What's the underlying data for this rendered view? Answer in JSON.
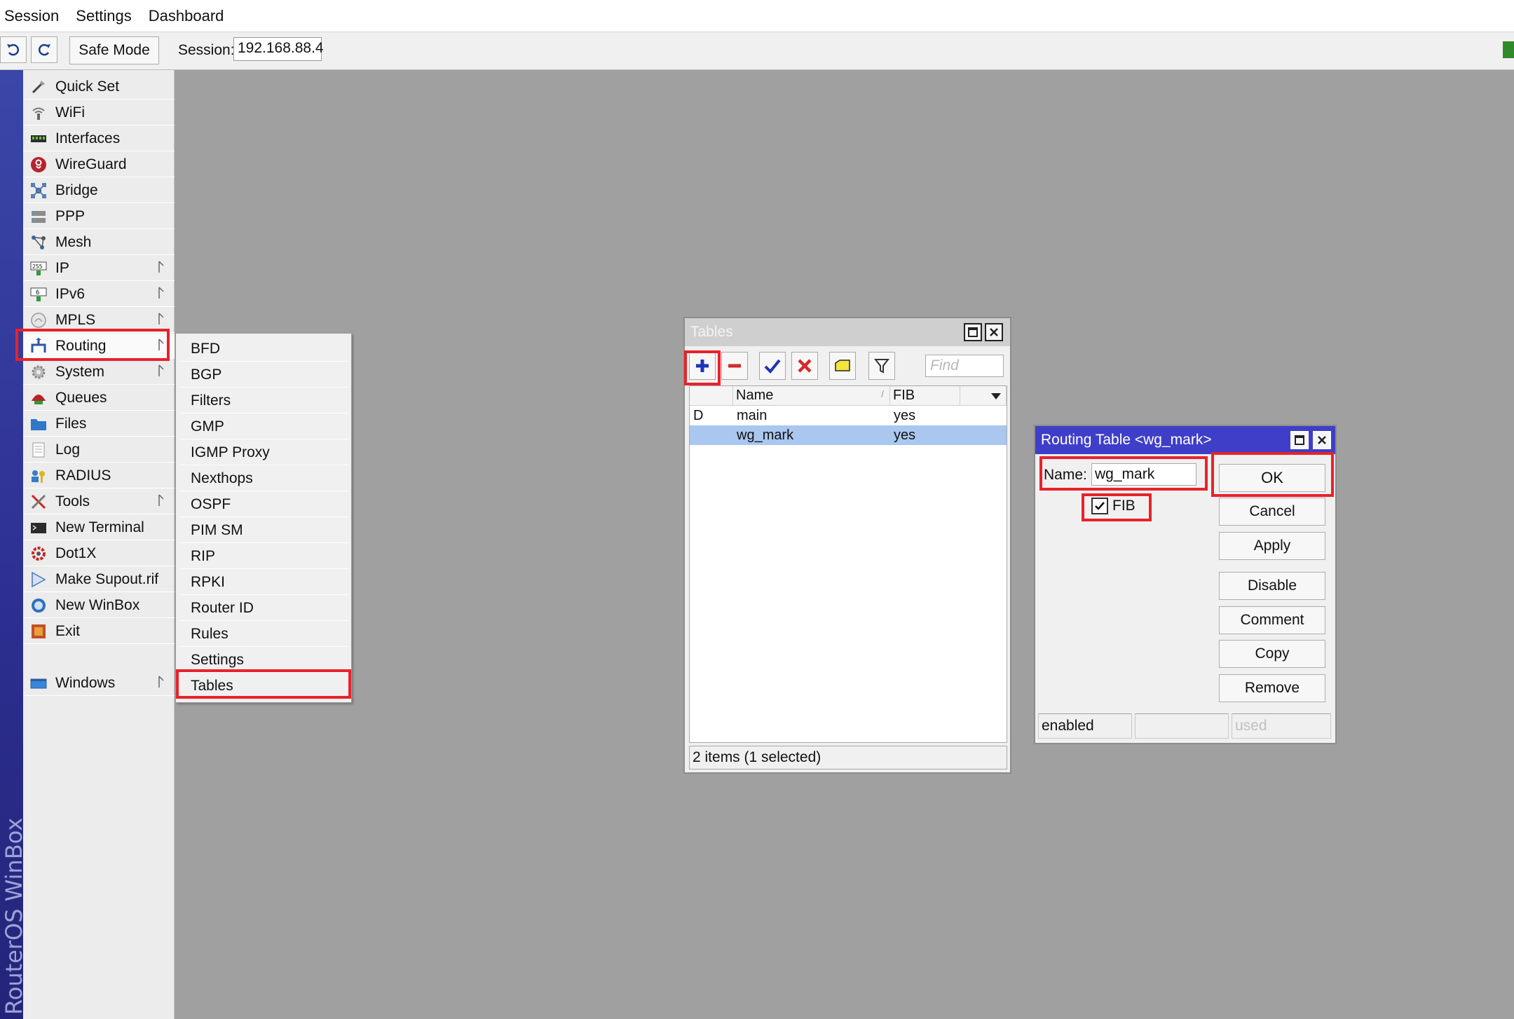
{
  "menubar": {
    "items": [
      "Session",
      "Settings",
      "Dashboard"
    ]
  },
  "toolbar": {
    "undo_icon": "undo-icon",
    "redo_icon": "redo-icon",
    "safe_mode_label": "Safe Mode",
    "session_label": "Session:",
    "session_value": "192.168.88.4"
  },
  "brand": {
    "vertical_label": "RouterOS WinBox"
  },
  "sidebar": {
    "items": [
      {
        "label": "Quick Set",
        "icon": "wand-icon",
        "has_submenu": false
      },
      {
        "label": "WiFi",
        "icon": "wifi-icon",
        "has_submenu": false
      },
      {
        "label": "Interfaces",
        "icon": "interfaces-icon",
        "has_submenu": false
      },
      {
        "label": "WireGuard",
        "icon": "wireguard-icon",
        "has_submenu": false
      },
      {
        "label": "Bridge",
        "icon": "bridge-icon",
        "has_submenu": false
      },
      {
        "label": "PPP",
        "icon": "ppp-icon",
        "has_submenu": false
      },
      {
        "label": "Mesh",
        "icon": "mesh-icon",
        "has_submenu": false
      },
      {
        "label": "IP",
        "icon": "ip-icon",
        "has_submenu": true
      },
      {
        "label": "IPv6",
        "icon": "ipv6-icon",
        "has_submenu": true
      },
      {
        "label": "MPLS",
        "icon": "mpls-icon",
        "has_submenu": true
      },
      {
        "label": "Routing",
        "icon": "routing-icon",
        "has_submenu": true
      },
      {
        "label": "System",
        "icon": "gear-icon",
        "has_submenu": true
      },
      {
        "label": "Queues",
        "icon": "queues-icon",
        "has_submenu": false
      },
      {
        "label": "Files",
        "icon": "folder-icon",
        "has_submenu": false
      },
      {
        "label": "Log",
        "icon": "log-icon",
        "has_submenu": false
      },
      {
        "label": "RADIUS",
        "icon": "radius-icon",
        "has_submenu": false
      },
      {
        "label": "Tools",
        "icon": "tools-icon",
        "has_submenu": true
      },
      {
        "label": "New Terminal",
        "icon": "terminal-icon",
        "has_submenu": false
      },
      {
        "label": "Dot1X",
        "icon": "dot1x-icon",
        "has_submenu": false
      },
      {
        "label": "Make Supout.rif",
        "icon": "supout-icon",
        "has_submenu": false
      },
      {
        "label": "New WinBox",
        "icon": "winbox-icon",
        "has_submenu": false
      },
      {
        "label": "Exit",
        "icon": "exit-icon",
        "has_submenu": false
      },
      {
        "label": "Windows",
        "icon": "windows-icon",
        "has_submenu": true
      }
    ]
  },
  "routing_submenu": {
    "items": [
      "BFD",
      "BGP",
      "Filters",
      "GMP",
      "IGMP Proxy",
      "Nexthops",
      "OSPF",
      "PIM SM",
      "RIP",
      "RPKI",
      "Router ID",
      "Rules",
      "Settings",
      "Tables"
    ]
  },
  "tables_window": {
    "title": "Tables",
    "find_placeholder": "Find",
    "columns": [
      "",
      "Name",
      "FIB"
    ],
    "rows": [
      {
        "flag": "D",
        "name": "main",
        "fib": "yes",
        "selected": false
      },
      {
        "flag": "",
        "name": "wg_mark",
        "fib": "yes",
        "selected": true
      }
    ],
    "status": "2 items (1 selected)"
  },
  "routing_table_dialog": {
    "title": "Routing Table <wg_mark>",
    "name_label": "Name:",
    "name_value": "wg_mark",
    "fib_label": "FIB",
    "fib_checked": true,
    "buttons": [
      "OK",
      "Cancel",
      "Apply",
      "Disable",
      "Comment",
      "Copy",
      "Remove"
    ],
    "status": [
      "enabled",
      "",
      "used"
    ]
  },
  "colors": {
    "highlight_red": "#e8222a",
    "dialog_title_blue": "#3f3ec8",
    "selection_blue": "#a9c7ef",
    "desktop_gray": "#a0a0a0"
  }
}
